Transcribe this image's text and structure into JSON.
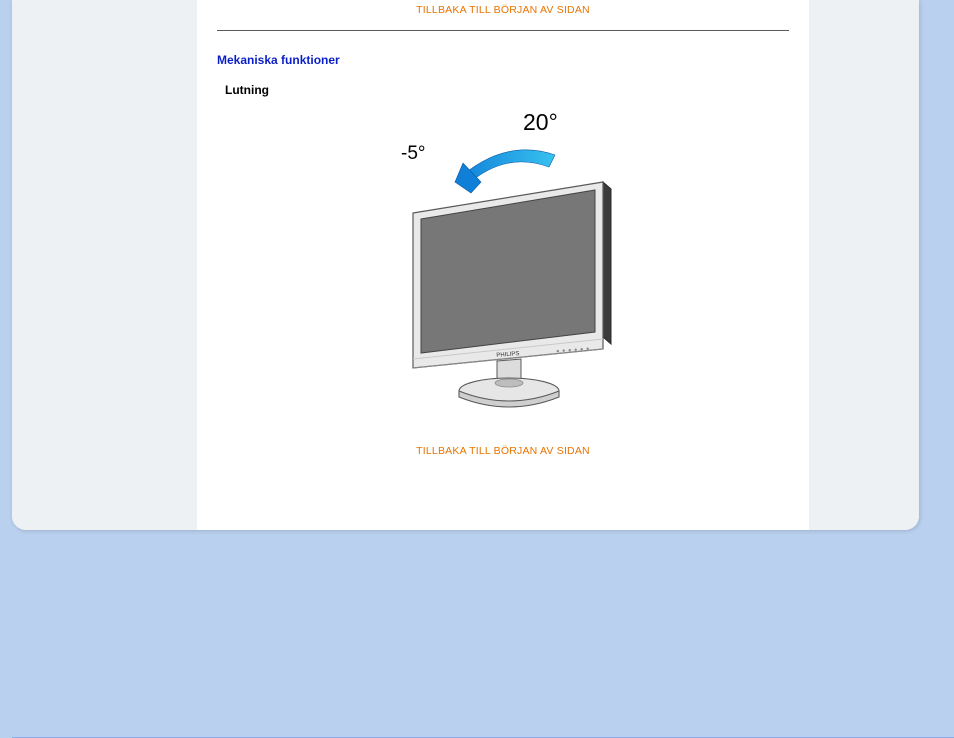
{
  "nav": {
    "back_to_top": "TILLBAKA TILL BÖRJAN AV SIDAN"
  },
  "section": {
    "title": "Mekaniska funktioner",
    "subheading": "Lutning"
  },
  "tilt": {
    "negative": "-5°",
    "positive": "20°",
    "brand": "PHILIPS"
  }
}
